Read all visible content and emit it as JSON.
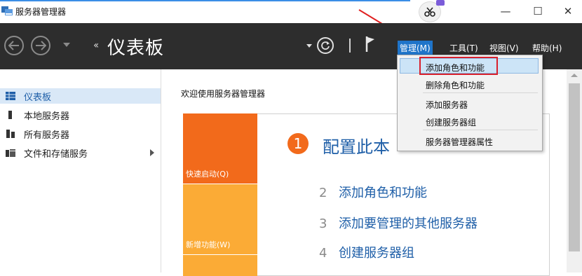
{
  "window": {
    "title": "服务器管理器",
    "minimize_glyph": "—",
    "maximize_glyph": "☐",
    "close_glyph": "✕"
  },
  "header": {
    "back_icon": "back-arrow-icon",
    "forward_icon": "forward-arrow-icon",
    "breadcrumb_arrows": "‹‹",
    "breadcrumb": "仪表板",
    "menus": [
      {
        "label": "管理(M)",
        "active": true
      },
      {
        "label": "工具(T)"
      },
      {
        "label": "视图(V)"
      },
      {
        "label": "帮助(H)"
      }
    ]
  },
  "sidebar": {
    "items": [
      {
        "label": "仪表板",
        "icon": "dashboard-grid-icon",
        "selected": true
      },
      {
        "label": "本地服务器",
        "icon": "server-icon"
      },
      {
        "label": "所有服务器",
        "icon": "servers-icon"
      },
      {
        "label": "文件和存储服务",
        "icon": "storage-icon",
        "expandable": true
      }
    ]
  },
  "main": {
    "welcome": "欢迎使用服务器管理器",
    "tiles": [
      {
        "label": "快速启动(Q)"
      },
      {
        "label": "新增功能(W)"
      }
    ],
    "quick_start": {
      "step1": {
        "num": "1",
        "label": "配置此本"
      },
      "steps": [
        {
          "num": "2",
          "label": "添加角色和功能"
        },
        {
          "num": "3",
          "label": "添加要管理的其他服务器"
        },
        {
          "num": "4",
          "label": "创建服务器组"
        }
      ]
    }
  },
  "dropdown": {
    "items": [
      {
        "label": "添加角色和功能",
        "highlighted": true
      },
      {
        "label": "删除角色和功能"
      },
      {
        "label": "添加服务器"
      },
      {
        "label": "创建服务器组"
      },
      {
        "label": "服务器管理器属性"
      }
    ]
  },
  "colors": {
    "header_bg": "#2d2d2d",
    "accent_blue": "#1f74c9",
    "tile_orange": "#f26a1b",
    "tile_yellow": "#fbab36",
    "highlight_red": "#d8202c"
  }
}
